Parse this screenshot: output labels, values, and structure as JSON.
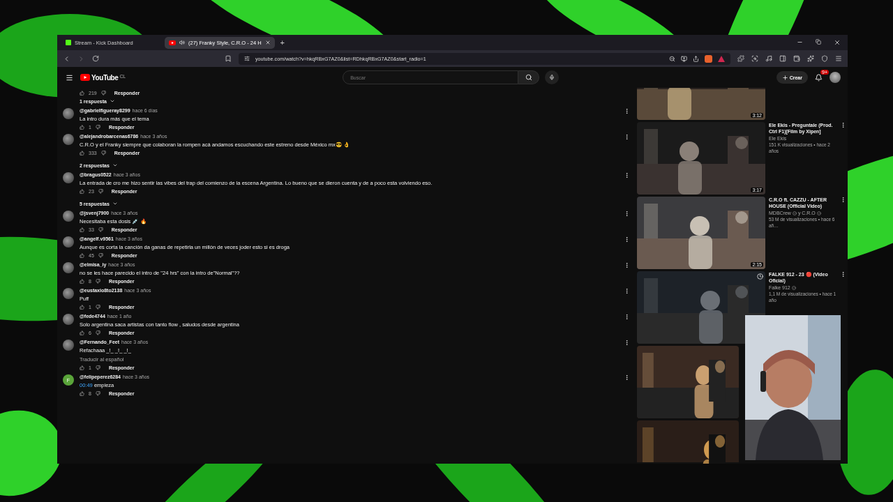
{
  "browser": {
    "tabs": [
      {
        "title": "Stream - Kick Dashboard",
        "kind": "kick",
        "selected": false,
        "audio": false
      },
      {
        "title": "(27) Franky Style, C.R.O - 24 H",
        "kind": "youtube",
        "selected": true,
        "audio": true
      }
    ],
    "new_tab": "+",
    "url": "youtube.com/watch?v=hkqRBxG7AZ0&list=RDhkqRBxG7AZ0&start_radio=1"
  },
  "youtube": {
    "logo": "YouTube",
    "region": "CL",
    "search": {
      "placeholder": "Buscar"
    },
    "create": "Crear",
    "notifications": "9+"
  },
  "comments": [
    {
      "kind": "partial",
      "likes": "219",
      "reply": "Responder",
      "replies": "1 respuesta"
    },
    {
      "kind": "comment",
      "author": "@gabrielfigueray8299",
      "time": "hace 6 días",
      "text": "La intro dura más que el tema",
      "likes": "1",
      "reply": "Responder"
    },
    {
      "kind": "comment",
      "author": "@alejandrobarcenas6786",
      "time": "hace 3 años",
      "text": "C.R.O y el Franky siempre que colaboran la rompen acá andamos escuchando este estreno desde México mx😎 👌",
      "likes": "333",
      "reply": "Responder",
      "replies": "2 respuestas"
    },
    {
      "kind": "comment",
      "author": "@bragus0522",
      "time": "hace 3 años",
      "text": "La entrada de cro me hizo sentir las vibes del trap del comienzo de la escena Argentina. Lo bueno que se dieron cuenta y de a poco esta volviendo eso.",
      "likes": "23",
      "reply": "Responder",
      "replies": "5 respuestas"
    },
    {
      "kind": "comment",
      "author": "@jsvenj7900",
      "time": "hace 3 años",
      "text": "Necesitaba esta dosis 💉 🔥",
      "likes": "33",
      "reply": "Responder"
    },
    {
      "kind": "comment",
      "author": "@angelf.v9561",
      "time": "hace 3 años",
      "text": "Aunque es corta la canción da ganas de repetirla un millón de veces joder esto si es droga",
      "likes": "45",
      "reply": "Responder"
    },
    {
      "kind": "comment",
      "author": "@elmisa_iy",
      "time": "hace 3 años",
      "text": "no se les hace parecido el intro de \"24 hrs\" con la intro de\"Normal\"??",
      "likes": "8",
      "reply": "Responder"
    },
    {
      "kind": "comment",
      "author": "@eustaxio8to2138",
      "time": "hace 3 años",
      "text": "Puff",
      "likes": "1",
      "reply": "Responder"
    },
    {
      "kind": "comment",
      "author": "@fede4744",
      "time": "hace 1 año",
      "text": "Solo argentina saca artistas con tanto flow , saludos desde argentina",
      "likes": "6",
      "reply": "Responder"
    },
    {
      "kind": "comment",
      "author": "@Fernando_Feet",
      "time": "hace 3 años",
      "text": "Refachaaa _!_ _!_ _!_",
      "translate": "Traducir al español",
      "likes": "1",
      "reply": "Responder"
    },
    {
      "kind": "comment",
      "author": "@felipeperez6284",
      "time": "hace 3 años",
      "avatar_letter": "F",
      "timestamp": "00:49",
      "text": "empieza",
      "likes": "8",
      "reply": "Responder"
    }
  ],
  "related": [
    {
      "kind": "video",
      "duration": "3:12"
    },
    {
      "kind": "video",
      "duration": "3:17",
      "title": "Ele Ekis - Preguntale (Prod. Ctrl F1)[Film by Xipen]",
      "channel": "Ele Ekis",
      "verified": false,
      "meta": "151 K visualizaciones • hace 2 años"
    },
    {
      "kind": "video",
      "duration": "2:15",
      "title": "C.R.O ft. CAZZU - AFTER HOUSE (Official Video)",
      "channel": "MDBCrew",
      "verified": true,
      "channel2": "y C.R.O",
      "meta": "53 M de visualizaciones • hace 6 añ…"
    },
    {
      "kind": "video",
      "title": "FALKE 912 - 23 🔴 (Video Oficial)",
      "channel": "Falke 912",
      "verified": true,
      "meta": "1,1 M de visualizaciones • hace 1 año",
      "hover": true
    },
    {
      "kind": "covered"
    },
    {
      "kind": "covered"
    }
  ]
}
